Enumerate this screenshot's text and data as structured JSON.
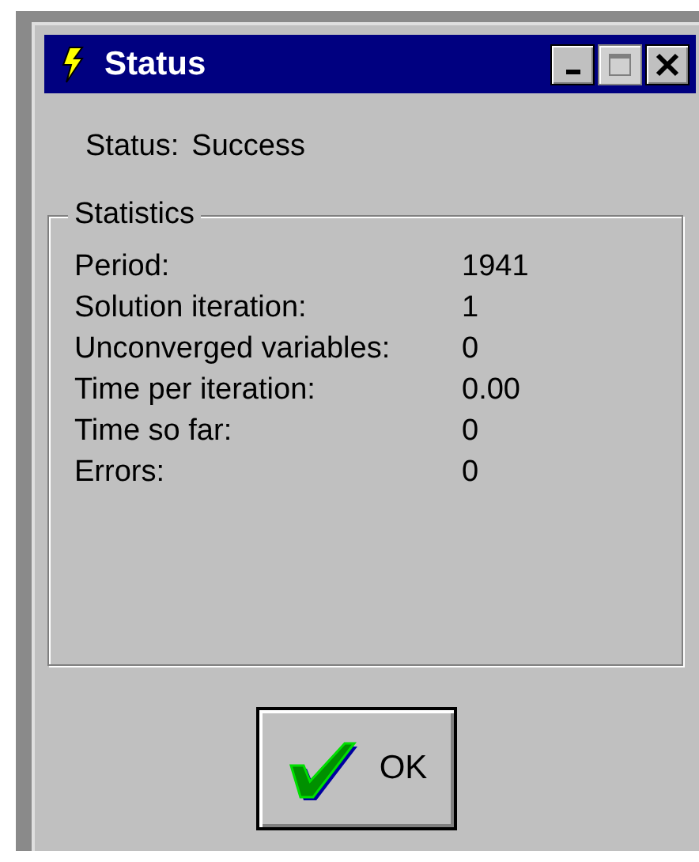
{
  "window": {
    "title": "Status"
  },
  "title_buttons": [
    {
      "kind": "minimize",
      "disabled": false
    },
    {
      "kind": "maximize",
      "disabled": true
    },
    {
      "kind": "close",
      "disabled": false
    }
  ],
  "status": {
    "label": "Status:",
    "value": "Success"
  },
  "statistics": {
    "title": "Statistics",
    "rows": [
      {
        "label": "Period:",
        "value": "1941"
      },
      {
        "label": "Solution iteration:",
        "value": "1"
      },
      {
        "label": "Unconverged variables:",
        "value": "0"
      },
      {
        "label": "Time per iteration:",
        "value": "0.00"
      },
      {
        "label": "Time so far:",
        "value": "0"
      },
      {
        "label": "Errors:",
        "value": "0"
      }
    ]
  },
  "ok_button": {
    "label": "OK"
  }
}
